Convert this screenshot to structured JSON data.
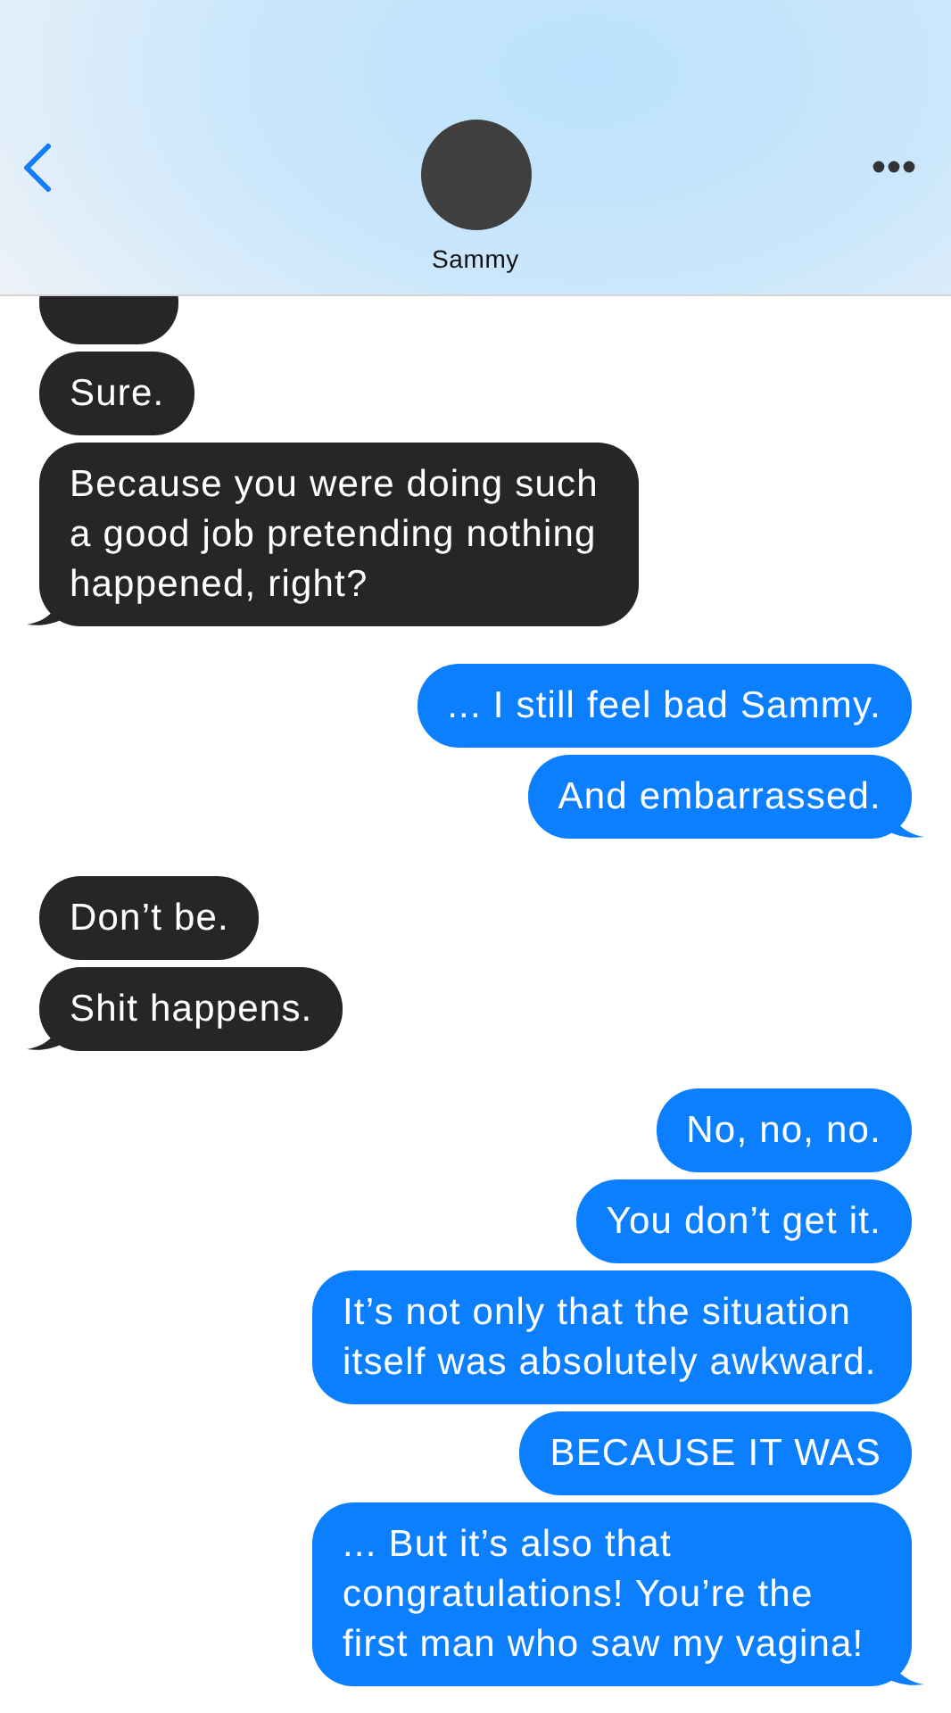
{
  "header": {
    "contact_name": "Sammy"
  },
  "messages": [
    {
      "kind": "received",
      "tail": false
    },
    {
      "kind": "received",
      "text": "Sure.",
      "tail": false
    },
    {
      "kind": "received",
      "text": "Because you were doing such a good job pretending nothing happened, right?",
      "tail": true
    },
    {
      "kind": "sent",
      "text": "... I still feel bad Sammy.",
      "tail": false
    },
    {
      "kind": "sent",
      "text": "And embarrassed.",
      "tail": true
    },
    {
      "kind": "received",
      "text": "Don’t be.",
      "tail": false
    },
    {
      "kind": "received",
      "text": "Shit happens.",
      "tail": true
    },
    {
      "kind": "sent",
      "text": "No, no, no.",
      "tail": false
    },
    {
      "kind": "sent",
      "text": "You don’t get it.",
      "tail": false
    },
    {
      "kind": "sent",
      "text": "It’s not only that the situation itself was absolutely awkward.",
      "tail": false
    },
    {
      "kind": "sent",
      "text": "BECAUSE IT WAS",
      "tail": false
    },
    {
      "kind": "sent",
      "text": "... But it’s also that congratulations! You’re the first man who saw my vagina!",
      "tail": true
    }
  ]
}
